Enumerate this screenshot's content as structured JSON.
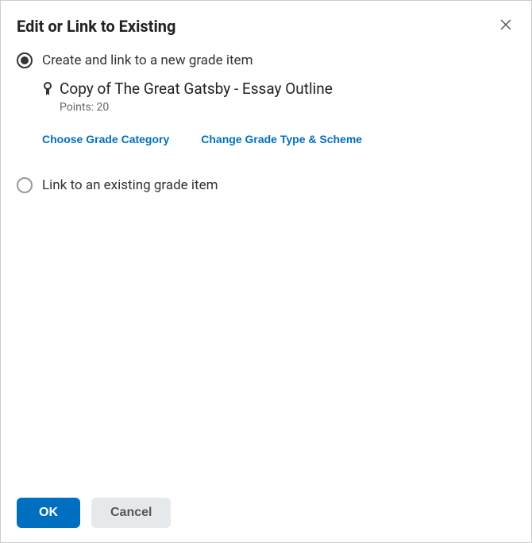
{
  "dialog": {
    "title": "Edit or Link to Existing"
  },
  "options": {
    "create_new": {
      "label": "Create and link to a new grade item",
      "selected": true,
      "grade_item_title": "Copy of The Great Gatsby - Essay Outline",
      "points_label": "Points: 20"
    },
    "link_existing": {
      "label": "Link to an existing grade item",
      "selected": false
    }
  },
  "actions": {
    "choose_category": "Choose Grade Category",
    "change_type_scheme": "Change Grade Type & Scheme"
  },
  "footer": {
    "ok": "OK",
    "cancel": "Cancel"
  }
}
